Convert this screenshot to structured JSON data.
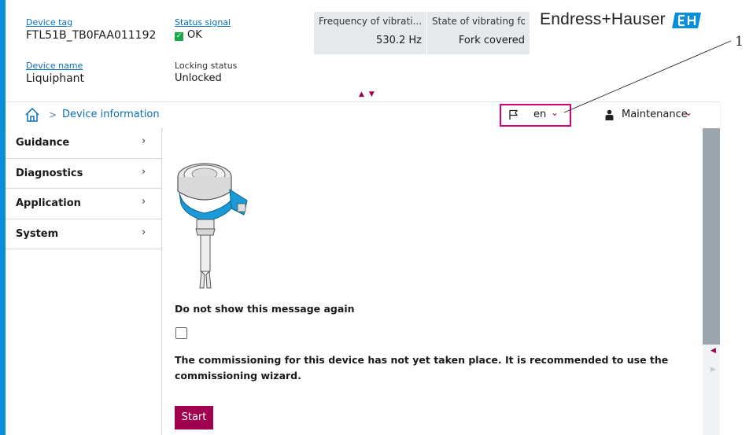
{
  "header": {
    "device_tag_label": "Device tag",
    "device_tag_value": "FTL51B_TB0FAA011192",
    "status_signal_label": "Status signal",
    "status_signal_value": "OK",
    "device_name_label": "Device name",
    "device_name_value": "Liquiphant",
    "locking_status_label": "Locking status",
    "locking_status_value": "Unlocked",
    "kpis": [
      {
        "label": "Frequency of vibrati...",
        "value": "530.2 Hz"
      },
      {
        "label": "State of vibrating fork",
        "value": "Fork covered"
      }
    ],
    "brand": "Endress+Hauser",
    "brand_color": "#0a8fd6"
  },
  "breadcrumb": {
    "separator": ">",
    "current": "Device information"
  },
  "toolbar": {
    "language": "en",
    "role": "Maintenance"
  },
  "callout": {
    "number": "1"
  },
  "sidebar": {
    "items": [
      {
        "label": "Guidance"
      },
      {
        "label": "Diagnostics"
      },
      {
        "label": "Application"
      },
      {
        "label": "System"
      }
    ]
  },
  "main": {
    "dont_show_label": "Do not show this message again",
    "checkbox_checked": false,
    "message": "The commissioning for this device has not yet taken place. It is recommended to use the commissioning wizard.",
    "start_button": "Start"
  },
  "colors": {
    "accent": "#0a8fd6",
    "primary": "#a0004f",
    "highlight": "#d2007f",
    "ok": "#19a94a"
  }
}
